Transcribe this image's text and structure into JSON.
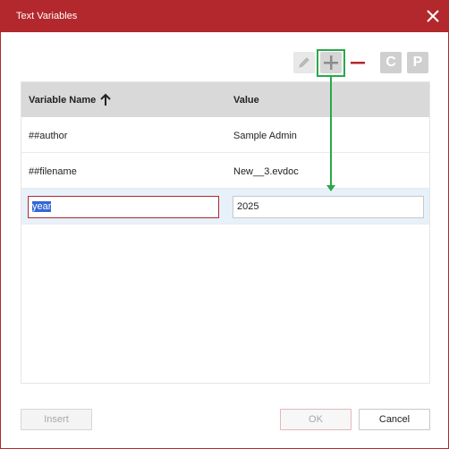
{
  "dialog": {
    "title": "Text Variables"
  },
  "toolbar": {
    "edit_icon": "pencil-icon",
    "add_icon": "plus-icon",
    "remove_icon": "minus-icon",
    "c_label": "C",
    "p_label": "P"
  },
  "grid": {
    "columns": [
      "Variable Name",
      "Value"
    ],
    "sort": "ascending",
    "rows": [
      {
        "name": "##author",
        "value": "Sample Admin"
      },
      {
        "name": "##filename",
        "value": "New__3.evdoc"
      }
    ],
    "edit_row": {
      "name": "year",
      "value": "2025"
    }
  },
  "buttons": {
    "insert": "Insert",
    "ok": "OK",
    "cancel": "Cancel"
  },
  "colors": {
    "accent": "#b3282d",
    "highlight": "#2aa84a",
    "selected_row": "#e7f1fa"
  }
}
